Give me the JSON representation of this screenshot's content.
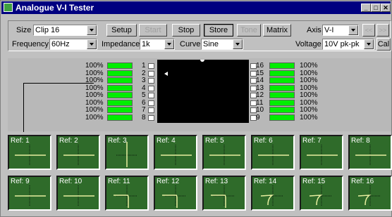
{
  "window": {
    "title": "Analogue V-I Tester"
  },
  "titlebar_buttons": [
    "_",
    "□",
    "✕"
  ],
  "controls": {
    "size_label": "Size",
    "size_value": "Clip 16",
    "frequency_label": "Frequency",
    "frequency_value": "60Hz",
    "impedance_label": "Impedance",
    "impedance_value": "1k",
    "curve_label": "Curve",
    "curve_value": "Sine",
    "axis_label": "Axis",
    "axis_value": "V-I",
    "voltage_label": "Voltage",
    "voltage_value": "10V pk-pk"
  },
  "buttons": {
    "setup": "Setup",
    "start": "Start",
    "stop": "Stop",
    "store": "Store",
    "tone": "Tone",
    "matrix": "Matrix",
    "prev": "<<",
    "next": ">>",
    "cal": "Cal"
  },
  "channels_left": [
    {
      "pct": "100%",
      "num": "1"
    },
    {
      "pct": "100%",
      "num": "2"
    },
    {
      "pct": "100%",
      "num": "3"
    },
    {
      "pct": "100%",
      "num": "4"
    },
    {
      "pct": "100%",
      "num": "5"
    },
    {
      "pct": "100%",
      "num": "6"
    },
    {
      "pct": "100%",
      "num": "7"
    },
    {
      "pct": "100%",
      "num": "8"
    }
  ],
  "channels_right": [
    {
      "pct": "100%",
      "num": "16"
    },
    {
      "pct": "100%",
      "num": "15"
    },
    {
      "pct": "100%",
      "num": "14"
    },
    {
      "pct": "100%",
      "num": "13"
    },
    {
      "pct": "100%",
      "num": "12"
    },
    {
      "pct": "100%",
      "num": "11"
    },
    {
      "pct": "100%",
      "num": "10"
    },
    {
      "pct": "100%",
      "num": "9"
    }
  ],
  "refs": [
    {
      "label": "Ref: 1",
      "curve": "flat"
    },
    {
      "label": "Ref: 2",
      "curve": "flat"
    },
    {
      "label": "Ref: 3",
      "curve": "vertical"
    },
    {
      "label": "Ref: 4",
      "curve": "flat"
    },
    {
      "label": "Ref: 5",
      "curve": "flat"
    },
    {
      "label": "Ref: 6",
      "curve": "flat"
    },
    {
      "label": "Ref: 7",
      "curve": "flat"
    },
    {
      "label": "Ref: 8",
      "curve": "flat"
    },
    {
      "label": "Ref: 9",
      "curve": "flat"
    },
    {
      "label": "Ref: 10",
      "curve": "flat"
    },
    {
      "label": "Ref: 11",
      "curve": "knee"
    },
    {
      "label": "Ref: 12",
      "curve": "knee"
    },
    {
      "label": "Ref: 13",
      "curve": "knee"
    },
    {
      "label": "Ref: 14",
      "curve": "knee-soft"
    },
    {
      "label": "Ref: 15",
      "curve": "knee-soft"
    },
    {
      "label": "Ref: 16",
      "curve": "knee-soft"
    }
  ],
  "colors": {
    "title_bar": "#000080",
    "level_bar": "#00ee00",
    "ref_bg": "#2f6b2a",
    "trace": "#e8f0a0"
  }
}
